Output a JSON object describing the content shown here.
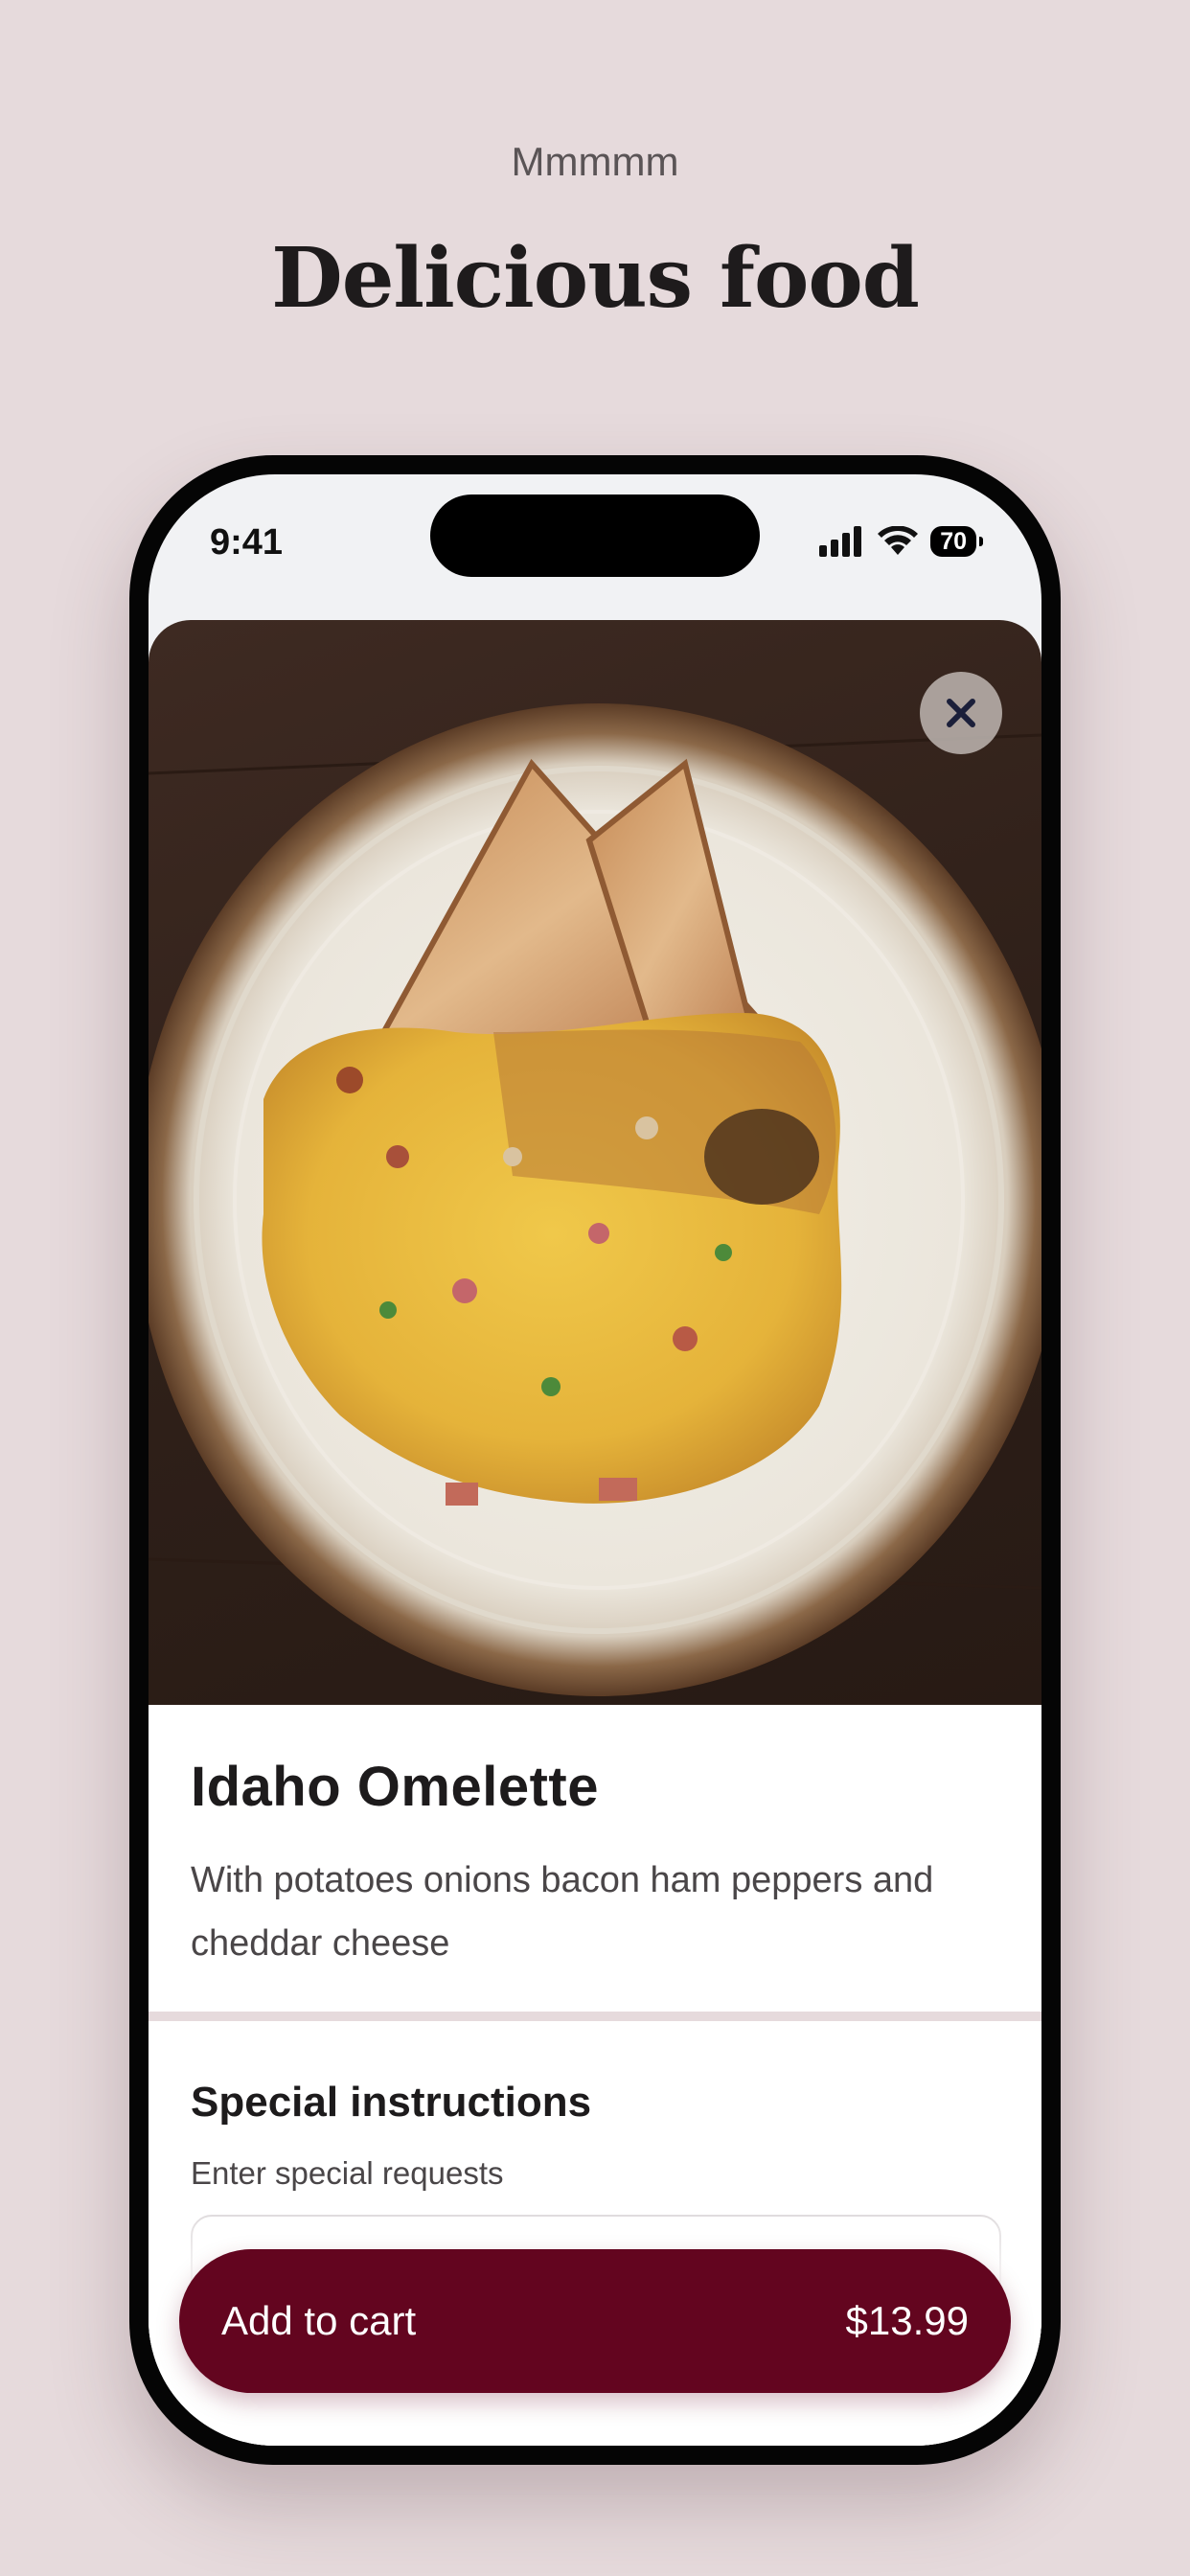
{
  "header": {
    "eyebrow": "Mmmmm",
    "headline": "Delicious food"
  },
  "statusbar": {
    "time": "9:41",
    "battery": "70",
    "icons": [
      "cellular-signal-icon",
      "wifi-icon",
      "battery-icon"
    ]
  },
  "item": {
    "image": "omelette-with-toast-photo",
    "name": "Idaho Omelette",
    "description": "With potatoes onions bacon ham peppers and cheddar cheese"
  },
  "instructions": {
    "title": "Special instructions",
    "subtitle": "Enter special requests",
    "value": ""
  },
  "cart": {
    "label": "Add to cart",
    "price": "$13.99"
  },
  "colors": {
    "background": "#e6dadc",
    "accent": "#63051f"
  }
}
